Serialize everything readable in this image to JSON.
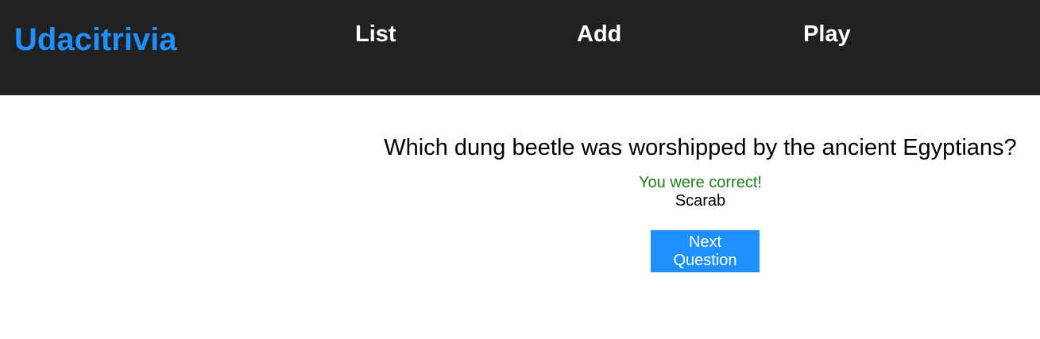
{
  "header": {
    "brand": "Udacitrivia",
    "nav": {
      "list_label": "List",
      "add_label": "Add",
      "play_label": "Play"
    }
  },
  "quiz": {
    "question": "Which dung beetle was worshipped by the ancient Egyptians?",
    "feedback": "You were correct!",
    "answer": "Scarab",
    "next_label": "Next Question"
  },
  "colors": {
    "header_bg": "#212121",
    "brand": "#1e90ff",
    "correct": "#1a7f1a",
    "button_bg": "#1e90ff"
  }
}
